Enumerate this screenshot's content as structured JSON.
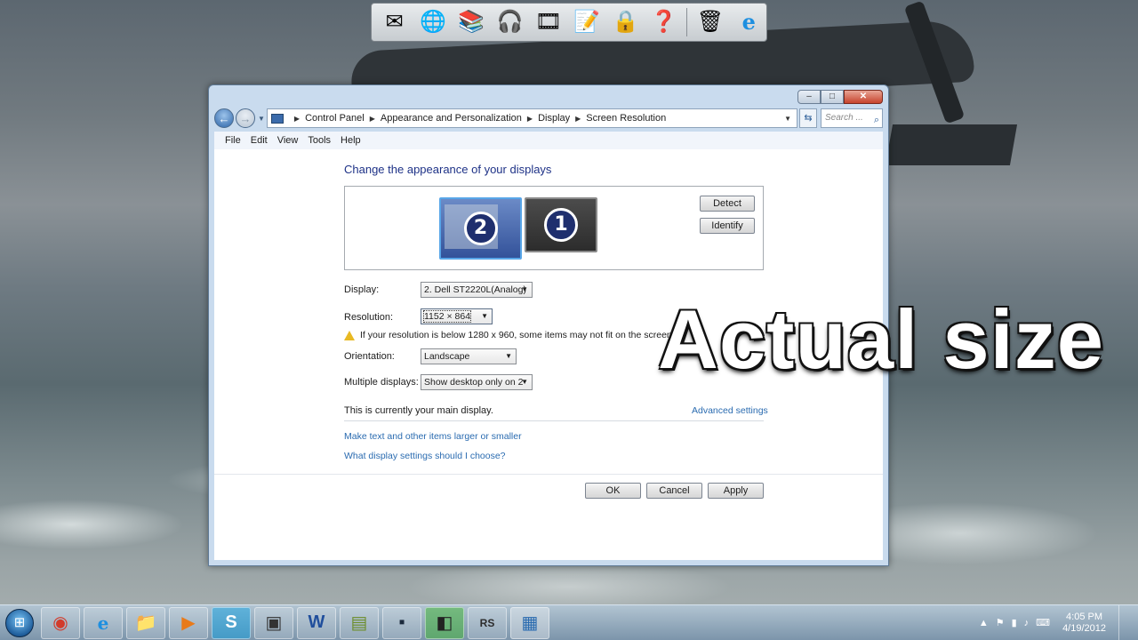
{
  "dock": {
    "icons": [
      "mail-icon",
      "globe-icon",
      "books-icon",
      "headphones-icon",
      "film-reel-icon",
      "notepad-icon",
      "padlock-icon",
      "help-icon",
      "recycle-bin-icon",
      "internet-explorer-icon"
    ],
    "glyphs": [
      "✉",
      "🌐",
      "📚",
      "🎧",
      "🎞",
      "📝",
      "🔒",
      "❓",
      "🗑",
      "e"
    ]
  },
  "window": {
    "breadcrumb": [
      "Control Panel",
      "Appearance and Personalization",
      "Display",
      "Screen Resolution"
    ],
    "search_placeholder": "Search ...",
    "menu": [
      "File",
      "Edit",
      "View",
      "Tools",
      "Help"
    ],
    "heading": "Change the appearance of your displays",
    "monitors": [
      "2",
      "1"
    ],
    "detect_label": "Detect",
    "identify_label": "Identify",
    "display_label": "Display:",
    "display_value": "2. Dell ST2220L(Analog)",
    "resolution_label": "Resolution:",
    "resolution_value": "1152 × 864",
    "warning": "If your resolution is below 1280 x 960, some items may not fit on the screen.",
    "orientation_label": "Orientation:",
    "orientation_value": "Landscape",
    "multiple_label": "Multiple displays:",
    "multiple_value": "Show desktop only on 2",
    "main_display_text": "This is currently your main display.",
    "advanced_link": "Advanced settings",
    "link_text_size": "Make text and other items larger or smaller",
    "link_help": "What display settings should I choose?",
    "ok_label": "OK",
    "cancel_label": "Cancel",
    "apply_label": "Apply"
  },
  "overlay_text": "Actual size",
  "taskbar": {
    "items": [
      "chrome-icon",
      "internet-explorer-icon",
      "folder-icon",
      "media-player-icon",
      "skype-icon",
      "app-icon",
      "word-icon",
      "notes-icon",
      "terminal-icon",
      "camera-icon",
      "app-badge-icon",
      "display-settings-icon"
    ],
    "glyphs": [
      "◉",
      "e",
      "📁",
      "▶",
      "S",
      "▣",
      "W",
      "▤",
      "▪",
      "◧",
      "RS",
      "▦"
    ],
    "time": "4:05 PM",
    "date": "4/19/2012"
  }
}
